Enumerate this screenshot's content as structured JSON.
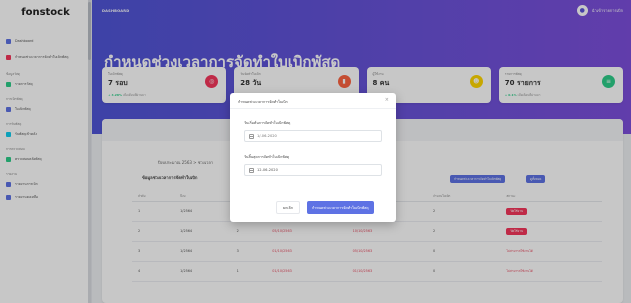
{
  "app": {
    "logo": "fonstock"
  },
  "topbar": {
    "breadcrumb": "DASHBOARD",
    "user_name": "นำเข้ารายการเบิก"
  },
  "sidebar": {
    "items": [
      {
        "label": "Dashboard",
        "color": "#5e72e4"
      },
      {
        "label": "กำหนดช่วงเวลาการจัดทำใบเบิกพัสดุ",
        "color": "#f5365c"
      }
    ],
    "sections": [
      {
        "title": "ข้อมูลวัสดุ",
        "items": [
          {
            "label": "รายการวัสดุ",
            "color": "#2dce89"
          }
        ]
      },
      {
        "title": "การเบิกพัสดุ",
        "items": [
          {
            "label": "ใบเบิกพัสดุ",
            "color": "#5e72e4"
          }
        ]
      },
      {
        "title": "การรับพัสดุ",
        "items": [
          {
            "label": "รับพัสดุเข้าคลัง",
            "color": "#11cdef"
          }
        ]
      },
      {
        "title": "การตรวจสอบ",
        "items": [
          {
            "label": "ตรวจสอบคลังพัสดุ",
            "color": "#2dce89"
          }
        ]
      },
      {
        "title": "รายงาน",
        "items": [
          {
            "label": "รายงานการเบิก",
            "color": "#5e72e4"
          },
          {
            "label": "รายงานคงเหลือ",
            "color": "#5e72e4"
          }
        ]
      }
    ]
  },
  "page": {
    "title": "กำหนดช่วงเวลาการจัดทำใบเบิกพัสดุ"
  },
  "cards": [
    {
      "label": "ใบเบิกพัสดุ",
      "value": "7 รอบ",
      "foot_up": "+ 4.28%",
      "foot": "เมื่อเดือนที่ผ่านมา",
      "badge_color": "#f5365c",
      "icon": "target-icon"
    },
    {
      "label": "วันจัดทำใบเบิก",
      "value": "28 วัน",
      "foot_up": "",
      "foot": "รอบล่าสุด",
      "badge_color": "#fb6340",
      "icon": "document-icon"
    },
    {
      "label": "ผู้ใช้งาน",
      "value": "8 คน",
      "foot_up": "",
      "foot": "",
      "badge_color": "#ffd600",
      "icon": "users-icon"
    },
    {
      "label": "รายการพัสดุ",
      "value": "70 รายการ",
      "foot_up": "+ 0.1%",
      "foot": "เมื่อเดือนที่ผ่านมา",
      "badge_color": "#2dce89",
      "icon": "box-icon"
    }
  ],
  "panel": {
    "breadcrumb": "ปีงบประมาณ 2563 > ช่วงเวลา",
    "subtitle": "ข้อมูลช่วงเวลาการจัดทำใบเบิก",
    "btn_add": "กำหนดช่วงเวลาการจัดทำใบเบิกพัสดุ",
    "btn_all": "ดูทั้งหมด",
    "columns": [
      "ลำดับ",
      "ปีงบ",
      "รอบ",
      "วันเริ่มต้น",
      "วันสิ้นสุด",
      "จำนวนใบเบิก",
      "สถานะ"
    ],
    "rows": [
      {
        "no": "1",
        "year": "1/2564",
        "round": "1",
        "start": "",
        "end": "",
        "count": "2",
        "status": "ปิดใช้งาน",
        "status_type": "pill"
      },
      {
        "no": "2",
        "year": "1/2564",
        "round": "2",
        "start": "05/10/2563",
        "end": "10/10/2563",
        "count": "2",
        "status": "ปิดใช้งาน",
        "status_type": "pill"
      },
      {
        "no": "3",
        "year": "1/2564",
        "round": "3",
        "start": "01/10/2563",
        "end": "05/10/2563",
        "count": "0",
        "status": "ไม่สามารถใช้งานได้",
        "status_type": "text"
      },
      {
        "no": "4",
        "year": "1/2564",
        "round": "1",
        "start": "01/10/2563",
        "end": "01/10/2563",
        "count": "0",
        "status": "ไม่สามารถใช้งานได้",
        "status_type": "text"
      }
    ]
  },
  "modal": {
    "title": "กำหนดช่วงเวลาการจัดทำใบเบิก",
    "close": "×",
    "start_label": "วันเริ่มต้นการจัดทำใบเบิกพัสดุ",
    "start_placeholder": "1/-06-2020",
    "end_label": "วันสิ้นสุดการจัดทำใบเบิกพัสดุ",
    "end_value": "12-06-2020",
    "cancel": "ยกเลิก",
    "save": "กำหนดช่วงเวลาการจัดทำใบเบิกพัสดุ"
  }
}
